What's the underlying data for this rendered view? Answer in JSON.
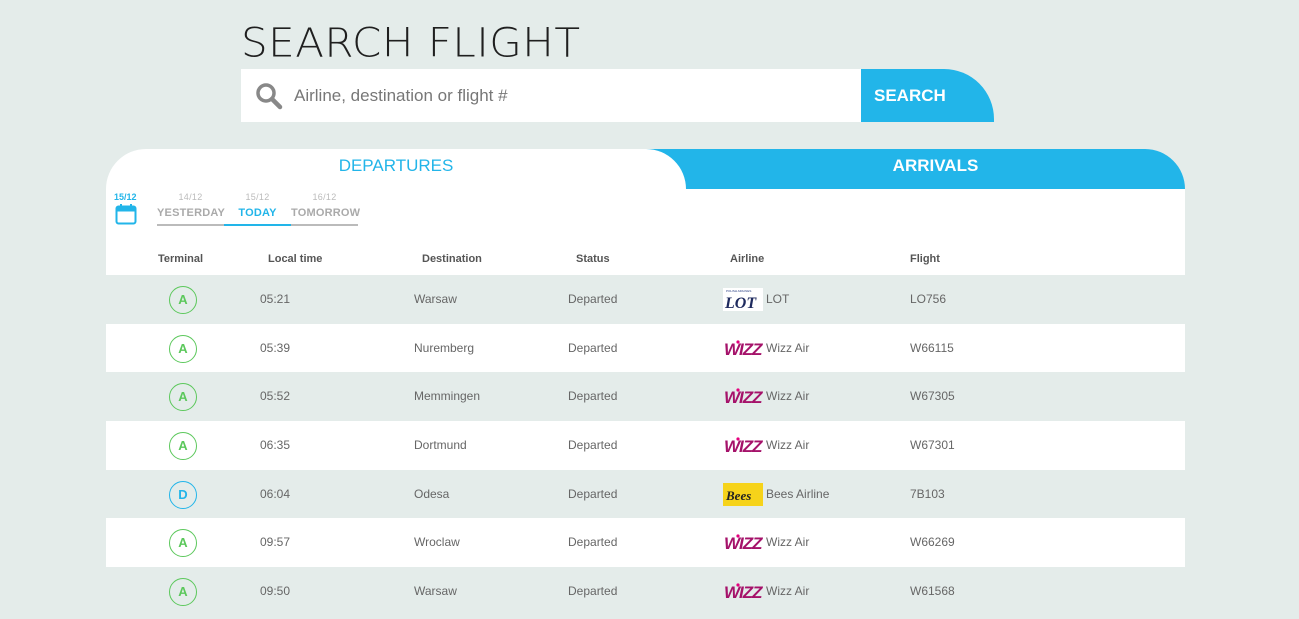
{
  "header": {
    "title": "SEARCH FLIGHT"
  },
  "search": {
    "placeholder": "Airline, destination or flight #",
    "value": "",
    "button_label": "SEARCH"
  },
  "tabs": {
    "departures": "DEPARTURES",
    "arrivals": "ARRIVALS"
  },
  "calendar": {
    "date": "15/12"
  },
  "days": [
    {
      "date": "14/12",
      "label": "YESTERDAY"
    },
    {
      "date": "15/12",
      "label": "TODAY"
    },
    {
      "date": "16/12",
      "label": "TOMORROW"
    }
  ],
  "columns": {
    "terminal": "Terminal",
    "local_time": "Local time",
    "destination": "Destination",
    "status": "Status",
    "airline": "Airline",
    "flight": "Flight"
  },
  "colors": {
    "accent": "#22b5e9",
    "terminal_a": "#5cc85c",
    "terminal_d": "#22b5e9",
    "background": "#e4ecea"
  },
  "flights": [
    {
      "terminal": "A",
      "time": "05:21",
      "destination": "Warsaw",
      "status": "Departed",
      "airline": "LOT",
      "logo": "lot-logo",
      "flight": "LO756"
    },
    {
      "terminal": "A",
      "time": "05:39",
      "destination": "Nuremberg",
      "status": "Departed",
      "airline": "Wizz Air",
      "logo": "wizz-logo",
      "flight": "W66115"
    },
    {
      "terminal": "A",
      "time": "05:52",
      "destination": "Memmingen",
      "status": "Departed",
      "airline": "Wizz Air",
      "logo": "wizz-logo",
      "flight": "W67305"
    },
    {
      "terminal": "A",
      "time": "06:35",
      "destination": "Dortmund",
      "status": "Departed",
      "airline": "Wizz Air",
      "logo": "wizz-logo",
      "flight": "W67301"
    },
    {
      "terminal": "D",
      "time": "06:04",
      "destination": "Odesa",
      "status": "Departed",
      "airline": "Bees Airline",
      "logo": "bees-logo",
      "flight": "7B103"
    },
    {
      "terminal": "A",
      "time": "09:57",
      "destination": "Wroclaw",
      "status": "Departed",
      "airline": "Wizz Air",
      "logo": "wizz-logo",
      "flight": "W66269"
    },
    {
      "terminal": "A",
      "time": "09:50",
      "destination": "Warsaw",
      "status": "Departed",
      "airline": "Wizz Air",
      "logo": "wizz-logo",
      "flight": "W61568"
    }
  ]
}
